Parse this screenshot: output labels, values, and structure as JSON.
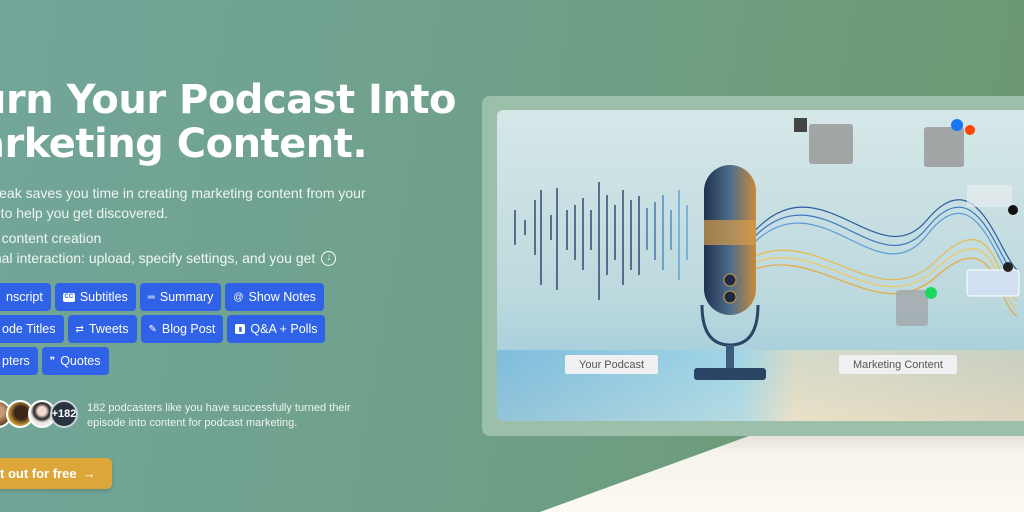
{
  "hero": {
    "title_line1": "urn Your Podcast Into",
    "title_line2": "arketing Content.",
    "subtitle_line1": "Speak saves you time in creating marketing content from your",
    "subtitle_line2": "es to help you get discovered."
  },
  "features": [
    {
      "text": "line content creation"
    },
    {
      "text": "inimal interaction: upload, specify settings, and you get",
      "icon": "download-circle-icon"
    }
  ],
  "chips": {
    "row1": [
      {
        "label": "nscript",
        "icon": ""
      },
      {
        "label": "Subtitles",
        "icon": "cc-icon"
      },
      {
        "label": "Summary",
        "icon": "summary-lines-icon"
      },
      {
        "label": "Show Notes",
        "icon": "notes-swirl-icon"
      }
    ],
    "row2": [
      {
        "label": "ode Titles",
        "icon": ""
      },
      {
        "label": "Tweets",
        "icon": "retweet-icon"
      },
      {
        "label": "Blog Post",
        "icon": "feather-icon"
      },
      {
        "label": "Q&A + Polls",
        "icon": "poll-chart-icon"
      }
    ],
    "row3": [
      {
        "label": "pters",
        "icon": ""
      },
      {
        "label": "Quotes",
        "icon": "quote-bubble-icon"
      }
    ]
  },
  "social_proof": {
    "more_count": "+182",
    "line1": "182 podcasters like you have successfully turned their",
    "line2": "episode into content for podcast marketing."
  },
  "cta": {
    "label": "t out for free",
    "arrow": "→"
  },
  "illustration": {
    "left_label": "Your Podcast",
    "right_label": "Marketing Content"
  },
  "colors": {
    "chip_blue": "#2f62e6",
    "cta_gold": "#dca63a",
    "bg_green": "#6fa08a",
    "bottom_cream": "#fdfaf4"
  }
}
